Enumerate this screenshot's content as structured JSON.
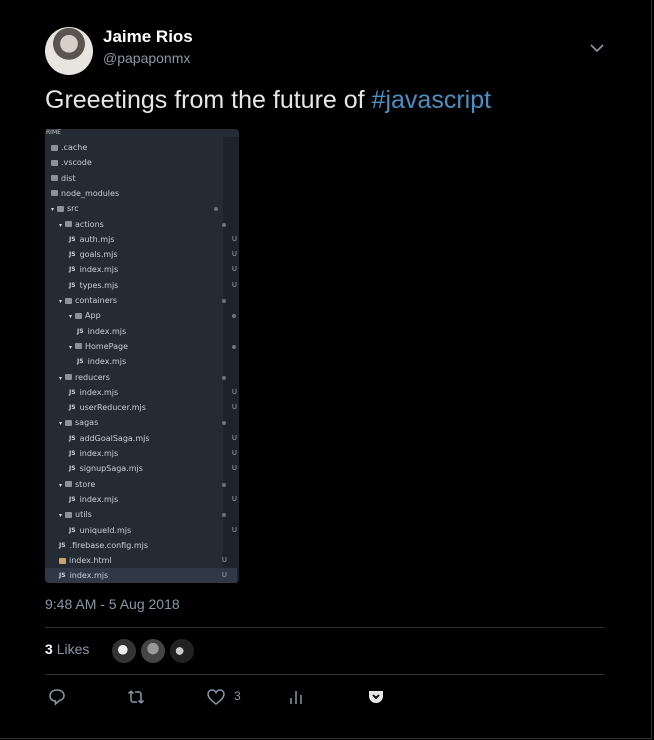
{
  "user": {
    "name": "Jaime Rios",
    "handle": "@papaponmx",
    "avatar": "profile-photo"
  },
  "tweet": {
    "text": "Greeetings from the future of ",
    "hashtag": "#javascript",
    "timestamp": "9:48 AM - 5 Aug 2018"
  },
  "image": {
    "title": "RIME",
    "rows": [
      {
        "label": ".cache",
        "kind": "folder",
        "indent": 0,
        "status": ""
      },
      {
        "label": ".vscode",
        "kind": "folder",
        "indent": 0,
        "status": ""
      },
      {
        "label": "dist",
        "kind": "folder",
        "indent": 0,
        "status": ""
      },
      {
        "label": "node_modules",
        "kind": "folder",
        "indent": 0,
        "status": ""
      },
      {
        "label": "src",
        "kind": "folder-open",
        "indent": 0,
        "status": "dot"
      },
      {
        "label": "actions",
        "kind": "folder-open",
        "indent": 1,
        "status": "dot"
      },
      {
        "label": "auth.mjs",
        "kind": "js",
        "indent": 2,
        "status": "U"
      },
      {
        "label": "goals.mjs",
        "kind": "js",
        "indent": 2,
        "status": "U"
      },
      {
        "label": "index.mjs",
        "kind": "js",
        "indent": 2,
        "status": "U"
      },
      {
        "label": "types.mjs",
        "kind": "js",
        "indent": 2,
        "status": "U"
      },
      {
        "label": "containers",
        "kind": "folder-open",
        "indent": 1,
        "status": "dot"
      },
      {
        "label": "App",
        "kind": "folder-open",
        "indent": 2,
        "status": "dot"
      },
      {
        "label": "index.mjs",
        "kind": "js",
        "indent": 3,
        "status": "U"
      },
      {
        "label": "HomePage",
        "kind": "folder-open",
        "indent": 2,
        "status": "dot"
      },
      {
        "label": "index.mjs",
        "kind": "js",
        "indent": 3,
        "status": "U"
      },
      {
        "label": "reducers",
        "kind": "folder-open",
        "indent": 1,
        "status": "dot"
      },
      {
        "label": "index.mjs",
        "kind": "js",
        "indent": 2,
        "status": "U"
      },
      {
        "label": "userReducer.mjs",
        "kind": "js",
        "indent": 2,
        "status": "U"
      },
      {
        "label": "sagas",
        "kind": "folder-open",
        "indent": 1,
        "status": "dot"
      },
      {
        "label": "addGoalSaga.mjs",
        "kind": "js",
        "indent": 2,
        "status": "U"
      },
      {
        "label": "index.mjs",
        "kind": "js",
        "indent": 2,
        "status": "U"
      },
      {
        "label": "signupSaga.mjs",
        "kind": "js",
        "indent": 2,
        "status": "U"
      },
      {
        "label": "store",
        "kind": "folder-open",
        "indent": 1,
        "status": "dot"
      },
      {
        "label": "index.mjs",
        "kind": "js",
        "indent": 2,
        "status": "U"
      },
      {
        "label": "utils",
        "kind": "folder-open",
        "indent": 1,
        "status": "dot"
      },
      {
        "label": "uniqueId.mjs",
        "kind": "js",
        "indent": 2,
        "status": "U"
      },
      {
        "label": ".firebase.config.mjs",
        "kind": "js",
        "indent": 1,
        "status": ""
      },
      {
        "label": "index.html",
        "kind": "html",
        "indent": 1,
        "status": "U"
      },
      {
        "label": "index.mjs",
        "kind": "js",
        "indent": 1,
        "status": "U",
        "selected": true
      }
    ]
  },
  "stats": {
    "likes_count": "3",
    "likes_label": "Likes"
  },
  "actions": {
    "like_count": "3",
    "reply": "reply-icon",
    "retweet": "retweet-icon",
    "like": "heart-icon",
    "analytics": "analytics-icon",
    "pocket": "pocket-icon"
  },
  "colors": {
    "background": "#000000",
    "text": "#e6e6e6",
    "muted": "#8899a6",
    "link": "#4a90c2",
    "border": "#2f3336",
    "editor_bg": "#252b35"
  }
}
